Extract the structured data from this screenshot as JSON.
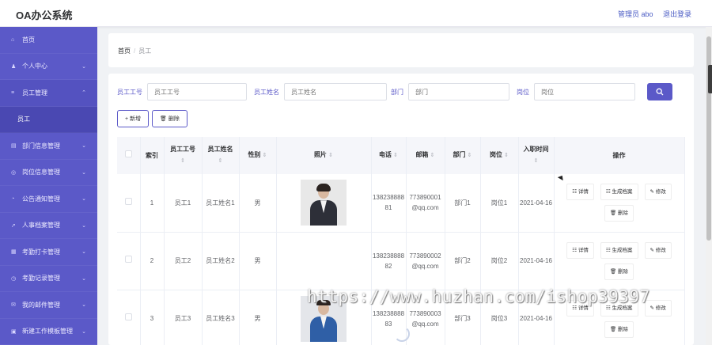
{
  "app": {
    "title": "OA办公系统",
    "user_label": "管理员 abo",
    "logout_label": "退出登录"
  },
  "sidebar": {
    "items": [
      {
        "icon": "home-icon",
        "glyph": "⌂",
        "label": "首页",
        "arrow": ""
      },
      {
        "icon": "user-icon",
        "glyph": "♟",
        "label": "个人中心",
        "arrow": "⌄"
      },
      {
        "icon": "list-icon",
        "glyph": "≡",
        "label": "员工管理",
        "arrow": "⌃"
      },
      {
        "icon": "",
        "glyph": "",
        "label": "员工",
        "arrow": "",
        "sub": true
      },
      {
        "icon": "folder-icon",
        "glyph": "▤",
        "label": "部门信息管理",
        "arrow": "⌄"
      },
      {
        "icon": "position-icon",
        "glyph": "◎",
        "label": "岗位信息管理",
        "arrow": "⌄"
      },
      {
        "icon": "notice-icon",
        "glyph": "◔",
        "label": "公告通知管理",
        "arrow": "⌄"
      },
      {
        "icon": "send-icon",
        "glyph": "➚",
        "label": "人事档案管理",
        "arrow": "⌄"
      },
      {
        "icon": "card-icon",
        "glyph": "▦",
        "label": "考勤打卡管理",
        "arrow": "⌄"
      },
      {
        "icon": "clock-icon",
        "glyph": "◷",
        "label": "考勤记录管理",
        "arrow": "⌄"
      },
      {
        "icon": "mail-icon",
        "glyph": "✉",
        "label": "我的邮件管理",
        "arrow": "⌄"
      },
      {
        "icon": "template-icon",
        "glyph": "▣",
        "label": "新建工作模板管理",
        "arrow": "⌄"
      }
    ]
  },
  "breadcrumb": {
    "home": "首页",
    "separator": "/",
    "current": "员工"
  },
  "search": {
    "fields": [
      {
        "label": "员工工号",
        "placeholder": "员工工号"
      },
      {
        "label": "员工姓名",
        "placeholder": "员工姓名"
      },
      {
        "label": "部门",
        "placeholder": "部门"
      },
      {
        "label": "岗位",
        "placeholder": "岗位"
      }
    ],
    "button_icon": "search-icon"
  },
  "actions": {
    "add": "+ 新增",
    "delete": "🗑 删除"
  },
  "table": {
    "headers": [
      "",
      "索引",
      "员工工号",
      "员工姓名",
      "性别",
      "照片",
      "电话",
      "邮箱",
      "部门",
      "岗位",
      "入职时间",
      "操作"
    ],
    "sort_glyph": "⇕",
    "rows": [
      {
        "index": "1",
        "emp_no": "员工1",
        "name": "员工姓名1",
        "gender": "男",
        "photo": "female",
        "phone": "13823888881",
        "email": "773890001@qq.com",
        "dept": "部门1",
        "post": "岗位1",
        "join_date": "2021-04-16"
      },
      {
        "index": "2",
        "emp_no": "员工2",
        "name": "员工姓名2",
        "gender": "男",
        "photo": "",
        "phone": "13823888882",
        "email": "773890002@qq.com",
        "dept": "部门2",
        "post": "岗位2",
        "join_date": "2021-04-16"
      },
      {
        "index": "3",
        "emp_no": "员工3",
        "name": "员工姓名3",
        "gender": "男",
        "photo": "male",
        "phone": "13823888883",
        "email": "773890003@qq.com",
        "dept": "部门3",
        "post": "岗位3",
        "join_date": "2021-04-16"
      }
    ],
    "ops": {
      "detail": "☷ 详情",
      "archive": "☷ 生成档案",
      "edit": "✎ 修改",
      "delete": "🗑 删除"
    }
  },
  "watermark": "https://www.huzhan.com/ishop39397",
  "colors": {
    "accent": "#5b59c8",
    "sidebar": "#5b59c8"
  }
}
